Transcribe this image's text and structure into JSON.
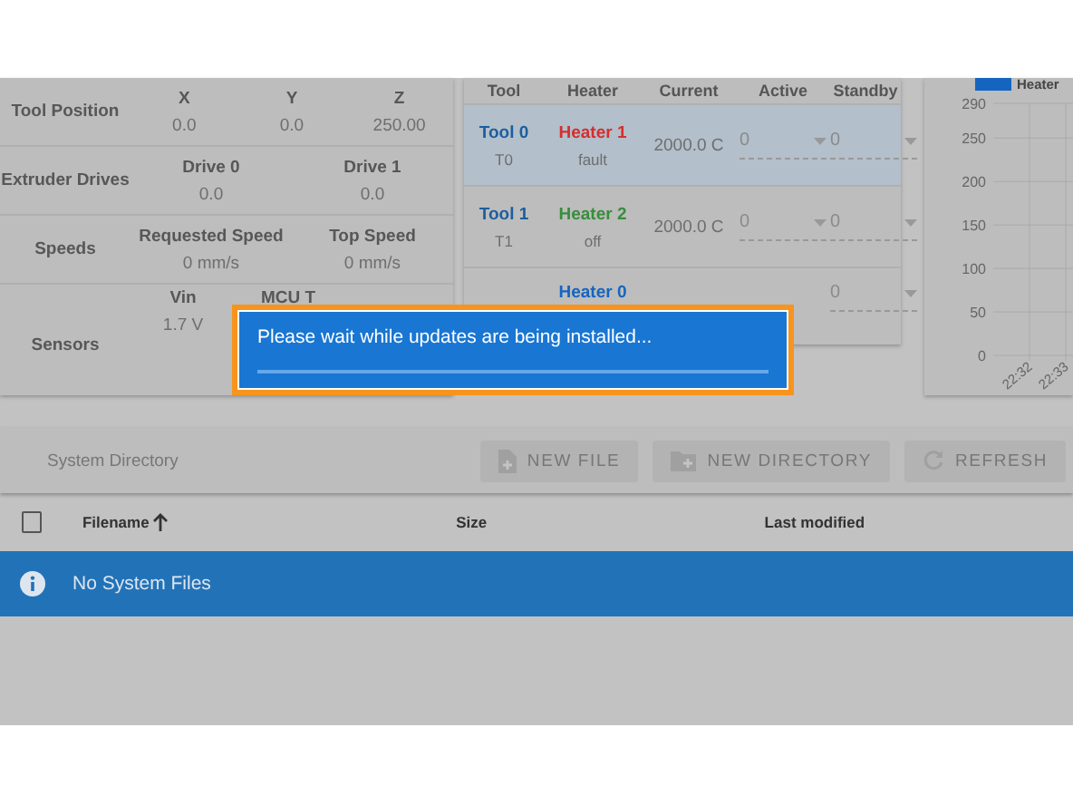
{
  "machine_status": {
    "rows": [
      {
        "label": "Tool Position",
        "cells": [
          {
            "heading": "X",
            "value": "0.0"
          },
          {
            "heading": "Y",
            "value": "0.0"
          },
          {
            "heading": "Z",
            "value": "250.00"
          }
        ]
      },
      {
        "label": "Extruder Drives",
        "cells": [
          {
            "heading": "Drive 0",
            "value": "0.0"
          },
          {
            "heading": "Drive 1",
            "value": "0.0"
          }
        ]
      },
      {
        "label": "Speeds",
        "cells": [
          {
            "heading": "Requested Speed",
            "value": "0 mm/s"
          },
          {
            "heading": "Top Speed",
            "value": "0 mm/s"
          }
        ]
      },
      {
        "label": "Sensors",
        "cells": [
          {
            "heading": "Vin",
            "value": "1.7 V"
          },
          {
            "heading": "MCU T"
          }
        ]
      }
    ]
  },
  "tools": {
    "columns": [
      "Tool",
      "Heater",
      "Current",
      "Active",
      "Standby"
    ],
    "rows": [
      {
        "selected": true,
        "tool": "Tool 0",
        "tool_id": "T0",
        "heater": "Heater 1",
        "color": "#d32f2f",
        "heater_state": "fault",
        "current": "2000.0 C",
        "active": "0",
        "standby": "0"
      },
      {
        "selected": false,
        "tool": "Tool 1",
        "tool_id": "T1",
        "heater": "Heater 2",
        "color": "#388e3c",
        "heater_state": "off",
        "current": "2000.0 C",
        "active": "0",
        "standby": "0"
      },
      {
        "selected": false,
        "heater": "Heater 0",
        "color": "#1565c0",
        "standby": "0"
      }
    ]
  },
  "chart": {
    "chart_data": {
      "type": "line",
      "categories": [
        "22:32",
        "22:33"
      ],
      "series": [
        {
          "name": "Heater",
          "color": "#1565c0",
          "values": [
            null,
            null
          ]
        }
      ],
      "ylim": [
        0,
        290
      ],
      "yticks": [
        0,
        50,
        100,
        150,
        200,
        250,
        290
      ],
      "grid": true
    }
  },
  "file_browser": {
    "title": "System Directory",
    "buttons": [
      {
        "label": "NEW FILE",
        "disabled": true
      },
      {
        "label": "NEW DIRECTORY",
        "disabled": true
      },
      {
        "label": "REFRESH",
        "disabled": true
      }
    ],
    "select_all": {
      "checked": false
    },
    "columns": [
      {
        "label": "Filename",
        "sorted": true
      },
      {
        "label": "Size",
        "sorted": false
      },
      {
        "label": "Last modified",
        "sorted": false
      }
    ],
    "empty_message": "No System Files"
  },
  "dialog": {
    "message": "Please wait while updates are being installed...",
    "progress": {
      "level": 1
    }
  }
}
